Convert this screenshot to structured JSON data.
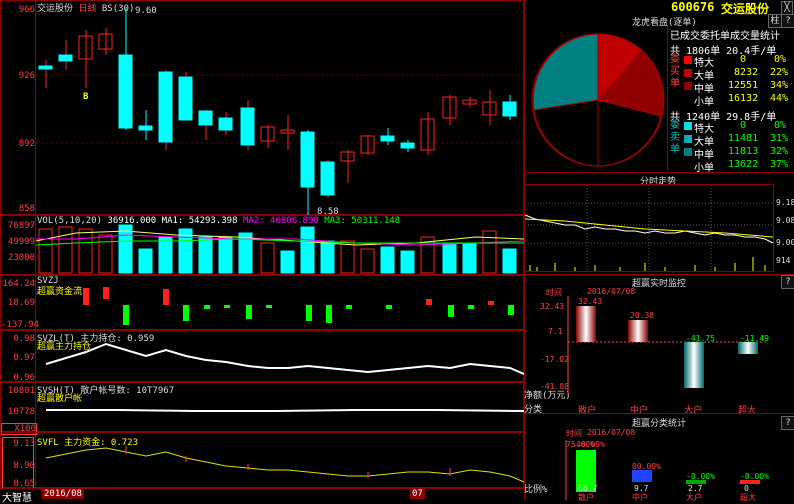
{
  "left": {
    "header": {
      "stock_name": "交运股份",
      "mode": "日线",
      "indicator": "BS(30)"
    },
    "price_axis": [
      "966",
      "926",
      "892",
      "858"
    ],
    "annotations": {
      "high": "9.60",
      "low": "8.58",
      "b_marker": "B"
    },
    "vol": {
      "label": "VOL(5,10,20)",
      "value": "36916.000",
      "ma1": "MA1: 54293.398",
      "ma2": "MA2: 46806.898",
      "ma3": "MA3: 50311.148",
      "axis": [
        "76897",
        "49999",
        "23000"
      ]
    },
    "svzj": {
      "label": "SVZJ",
      "subtitle": "超赢资金流",
      "axis": [
        "164.24",
        "18.69",
        "-137.94"
      ]
    },
    "svzl": {
      "label": "SVZL(T) 主力持仓: 0.959",
      "subtitle": "超赢主力持仓",
      "axis": [
        "0.98",
        "0.97",
        "0.96"
      ]
    },
    "svsh": {
      "label": "SVSH(T) 散户帐号数: 10T7967",
      "subtitle": "超赢散户帐",
      "axis": [
        "10801",
        "10778"
      ],
      "unit": "X100"
    },
    "svfl": {
      "label": "SVFL 主力资金: 0.723",
      "axis": [
        "9.13",
        "8.90",
        "8.65"
      ]
    },
    "footer": {
      "logo": "大智慧",
      "date1": "2016/08",
      "date2": "07"
    }
  },
  "right": {
    "code": "600676",
    "name": "交运股份",
    "selector": "龙虎看盘(逐单)",
    "buttons": {
      "alt": "柱",
      "close": "╳"
    },
    "stat_title": "已成交委托单成交量统计",
    "buy": {
      "label": "委买单",
      "header": "共 1806单 20.4手/单",
      "rows": [
        {
          "name": "特大",
          "vol": "0",
          "pct": "0%",
          "color": "#ff0000"
        },
        {
          "name": "大单",
          "vol": "8232",
          "pct": "22%",
          "color": "#c00000"
        },
        {
          "name": "中单",
          "vol": "12551",
          "pct": "34%",
          "color": "#900000"
        },
        {
          "name": "小单",
          "vol": "16132",
          "pct": "44%",
          "color": "#600000"
        }
      ]
    },
    "sell": {
      "label": "委卖单",
      "header": "共 1240单 29.8手/单",
      "rows": [
        {
          "name": "特大",
          "vol": "0",
          "pct": "0%",
          "color": "#00e0e0"
        },
        {
          "name": "大单",
          "vol": "11481",
          "pct": "31%",
          "color": "#00b0b0"
        },
        {
          "name": "中单",
          "vol": "11813",
          "pct": "32%",
          "color": "#008080"
        },
        {
          "name": "小单",
          "vol": "13622",
          "pct": "37%",
          "color": "#006060"
        }
      ]
    },
    "intraday": {
      "title": "分时走势",
      "axis": [
        "9.18",
        "9.08",
        "9.00"
      ],
      "vol_axis": "914"
    },
    "monitor": {
      "title": "超赢实时监控",
      "time_label": "时间",
      "date": "2016/07/08",
      "axis": [
        "32.43",
        "7.1",
        "-17.02",
        "-41.08"
      ],
      "net_label": "净额(万元)",
      "cat_label": "分类",
      "bars": [
        {
          "name": "散户",
          "value": "32.43"
        },
        {
          "name": "中户",
          "value": "20.38"
        },
        {
          "name": "大户",
          "value": "-41.75"
        },
        {
          "name": "超大",
          "value": "-11.49"
        }
      ]
    },
    "classify": {
      "title": "超赢分类统计",
      "time_label": "时间",
      "date": "2016/07/08",
      "axis": [
        "75.60%"
      ],
      "ratio_label": "比例%",
      "bars": [
        {
          "name": "散户",
          "top": "40.09%",
          "bottom": "66.7"
        },
        {
          "name": "中户",
          "top": "00.00%",
          "bottom": "9.7"
        },
        {
          "name": "大户",
          "top": "-0.00%",
          "bottom": "2.7"
        },
        {
          "name": "超大",
          "top": "-0.00%",
          "bottom": "0"
        }
      ]
    }
  }
}
